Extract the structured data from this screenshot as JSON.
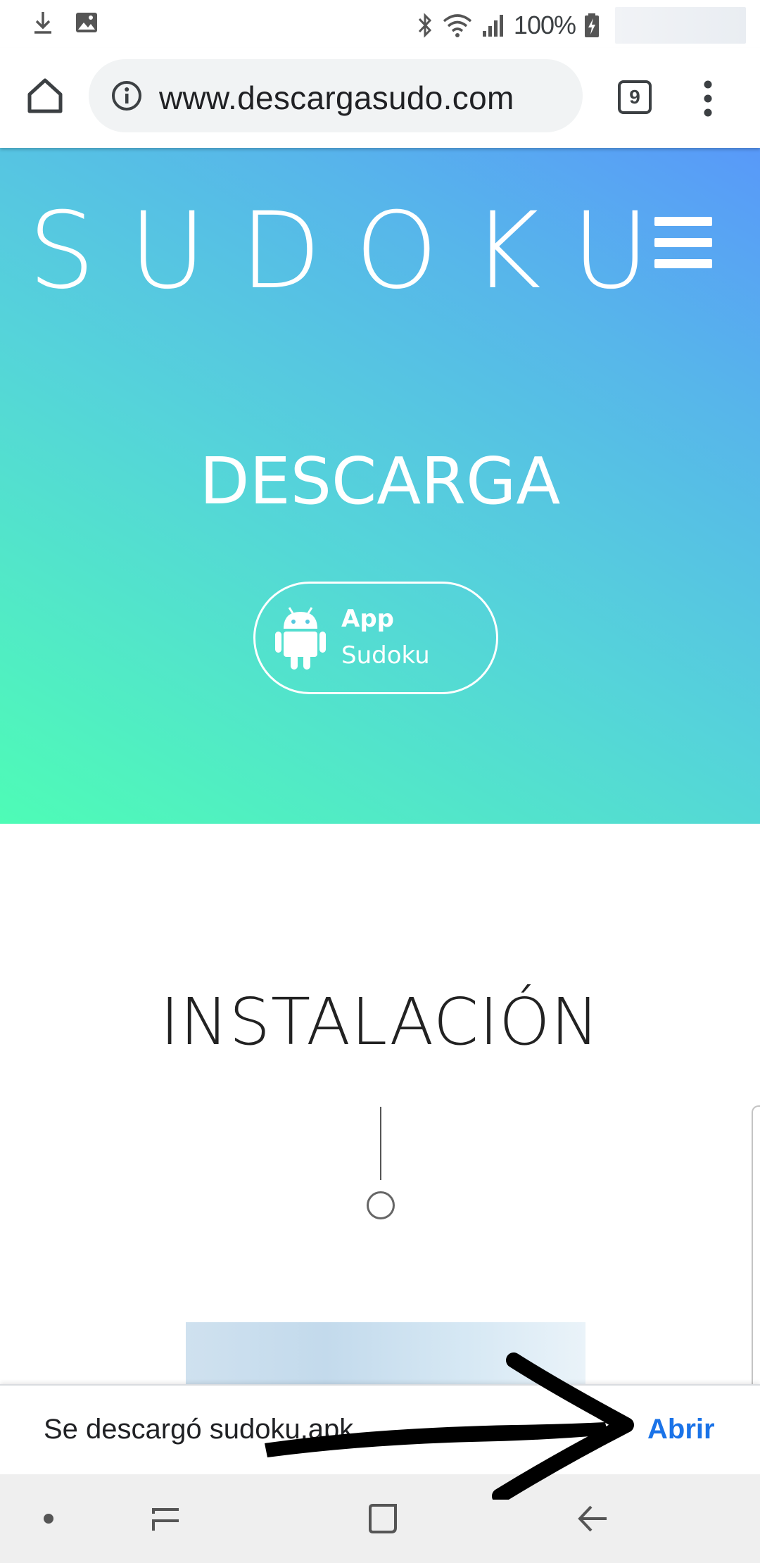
{
  "status_bar": {
    "battery_percent": "100%",
    "icons": [
      "download-icon",
      "image-icon",
      "bluetooth-icon",
      "wifi-icon",
      "signal-icon",
      "battery-icon"
    ]
  },
  "browser": {
    "url": "www.descargasudo.com",
    "tab_count": "9",
    "icons": [
      "home-icon",
      "info-icon",
      "tabs-icon",
      "more-icon"
    ]
  },
  "hero": {
    "logo": "SUDOKU",
    "title": "DESCARGA",
    "app_button": {
      "line1": "App",
      "line2": "Sudoku",
      "icon": "android-icon"
    },
    "gradient": [
      "#4efcb6",
      "#55d3da",
      "#5899f9"
    ]
  },
  "content": {
    "section_title": "INSTALACIÓN"
  },
  "snackbar": {
    "message": "Se descargó sudoku.apk",
    "action": "Abrir",
    "action_color": "#1a73e8"
  },
  "nav_bar": {
    "icons": [
      "dot-icon",
      "recent-apps-icon",
      "home-square-icon",
      "back-arrow-icon"
    ]
  }
}
